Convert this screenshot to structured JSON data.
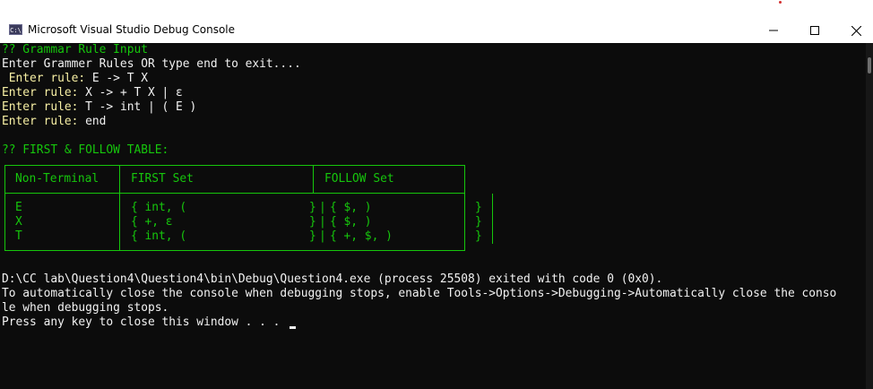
{
  "window": {
    "title": "Microsoft Visual Studio Debug Console",
    "icon_label": "C:\\"
  },
  "console": {
    "heading_input": "?? Grammar Rule Input",
    "prompt_intro": "Enter Grammer Rules OR type end to exit....",
    "rules": [
      {
        "prompt": " Enter rule:",
        "value": " E -> T X"
      },
      {
        "prompt": "Enter rule:",
        "value": " X -> + T X | ε"
      },
      {
        "prompt": "Enter rule:",
        "value": " T -> int | ( E )"
      },
      {
        "prompt": "Enter rule:",
        "value": " end"
      }
    ],
    "heading_table": "?? FIRST & FOLLOW TABLE:",
    "table": {
      "headers": [
        "Non-Terminal",
        "FIRST Set",
        "FOLLOW Set"
      ],
      "rows": [
        {
          "nt": "E",
          "first": "{ int, (",
          "first_close": "}",
          "follow": "{ $, )",
          "follow_close": "}"
        },
        {
          "nt": "X",
          "first": "{ +, ε",
          "first_close": "}",
          "follow": "{ $, )",
          "follow_close": "}"
        },
        {
          "nt": "T",
          "first": "{ int, (",
          "first_close": "}",
          "follow": "{ +, $, )",
          "follow_close": "}"
        }
      ]
    },
    "exit_message": "D:\\CC lab\\Question4\\Question4\\bin\\Debug\\Question4.exe (process 25508) exited with code 0 (0x0).",
    "auto_close_line1": "To automatically close the console when debugging stops, enable Tools->Options->Debugging->Automatically close the conso",
    "auto_close_line2": "le when debugging stops.",
    "press_key": "Press any key to close this window . . ."
  },
  "colors": {
    "console_bg": "#0c0c0c",
    "green": "#16c60c",
    "yellow": "#f9f1a5",
    "white": "#f2f2f2"
  }
}
